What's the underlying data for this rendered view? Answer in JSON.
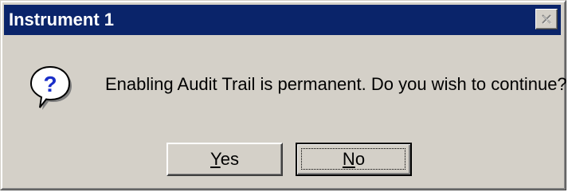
{
  "window": {
    "title": "Instrument 1",
    "close_icon": "close-icon"
  },
  "dialog": {
    "icon": "question-icon",
    "icon_glyph": "?",
    "message": "Enabling Audit Trail is permanent.  Do you wish to continue?"
  },
  "buttons": {
    "yes": {
      "mnemonic": "Y",
      "rest": "es"
    },
    "no": {
      "mnemonic": "N",
      "rest": "o",
      "default": true
    }
  },
  "colors": {
    "titlebar": "#0a246a",
    "face": "#d4d0c8",
    "icon_blue": "#1a2ec8"
  }
}
